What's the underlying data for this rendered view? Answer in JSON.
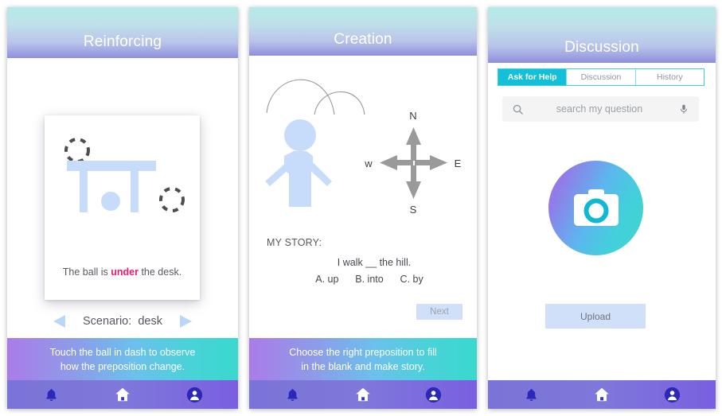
{
  "panels": [
    {
      "id": "reinforcing",
      "title": "Reinforcing",
      "card": {
        "caption_prefix": "The ball is ",
        "caption_keyword": "under",
        "caption_suffix": " the desk.",
        "art": "desk-with-ball-illustration"
      },
      "scenario": {
        "prev_icon": "left-triangle-icon",
        "label": "Scenario:  desk",
        "next_icon": "right-triangle-icon"
      },
      "banner_line1": "Touch the ball in dash to observe",
      "banner_line2": "how the preposition change."
    },
    {
      "id": "creation",
      "title": "Creation",
      "art": "hills-stickfigure-compass-illustration",
      "compass": {
        "north": "N",
        "south": "S",
        "east": "E",
        "west": "w"
      },
      "story": {
        "title": "MY STORY:",
        "sentence": "I walk  __  the hill.",
        "options": "A. up      B. into      C. by"
      },
      "next_label": "Next",
      "banner_line1": "Choose the right preposition to fill",
      "banner_line2": "in the blank and make story."
    },
    {
      "id": "discussion",
      "title": "Discussion",
      "tabs": [
        {
          "label": "Ask for Help",
          "active": true
        },
        {
          "label": "Discussion",
          "active": false
        },
        {
          "label": "History",
          "active": false
        }
      ],
      "search": {
        "placeholder": "search my question",
        "left_icon": "search-icon",
        "right_icon": "microphone-icon"
      },
      "camera": {
        "icon": "camera-icon"
      },
      "upload_label": "Upload"
    }
  ],
  "navbar": {
    "items": [
      {
        "icon": "bell-icon",
        "name": "notifications"
      },
      {
        "icon": "home-icon",
        "name": "home"
      },
      {
        "icon": "user-avatar-icon",
        "name": "profile"
      }
    ]
  },
  "colors": {
    "header_top": "#b5ebe5",
    "header_bottom": "#8e8fdd",
    "banner_left": "#aa7ce9",
    "banner_right": "#39d8cc",
    "navbar": "#7a74d8",
    "nav_icon": "#2b27b8",
    "accent_pink": "#f5176e",
    "light_blue": "#cfe0f8",
    "figure_blue": "#c7dcfa",
    "tab_active": "#14c0d8",
    "tab_border": "#3ccfe0",
    "camera_lens": "#10b8d4"
  }
}
